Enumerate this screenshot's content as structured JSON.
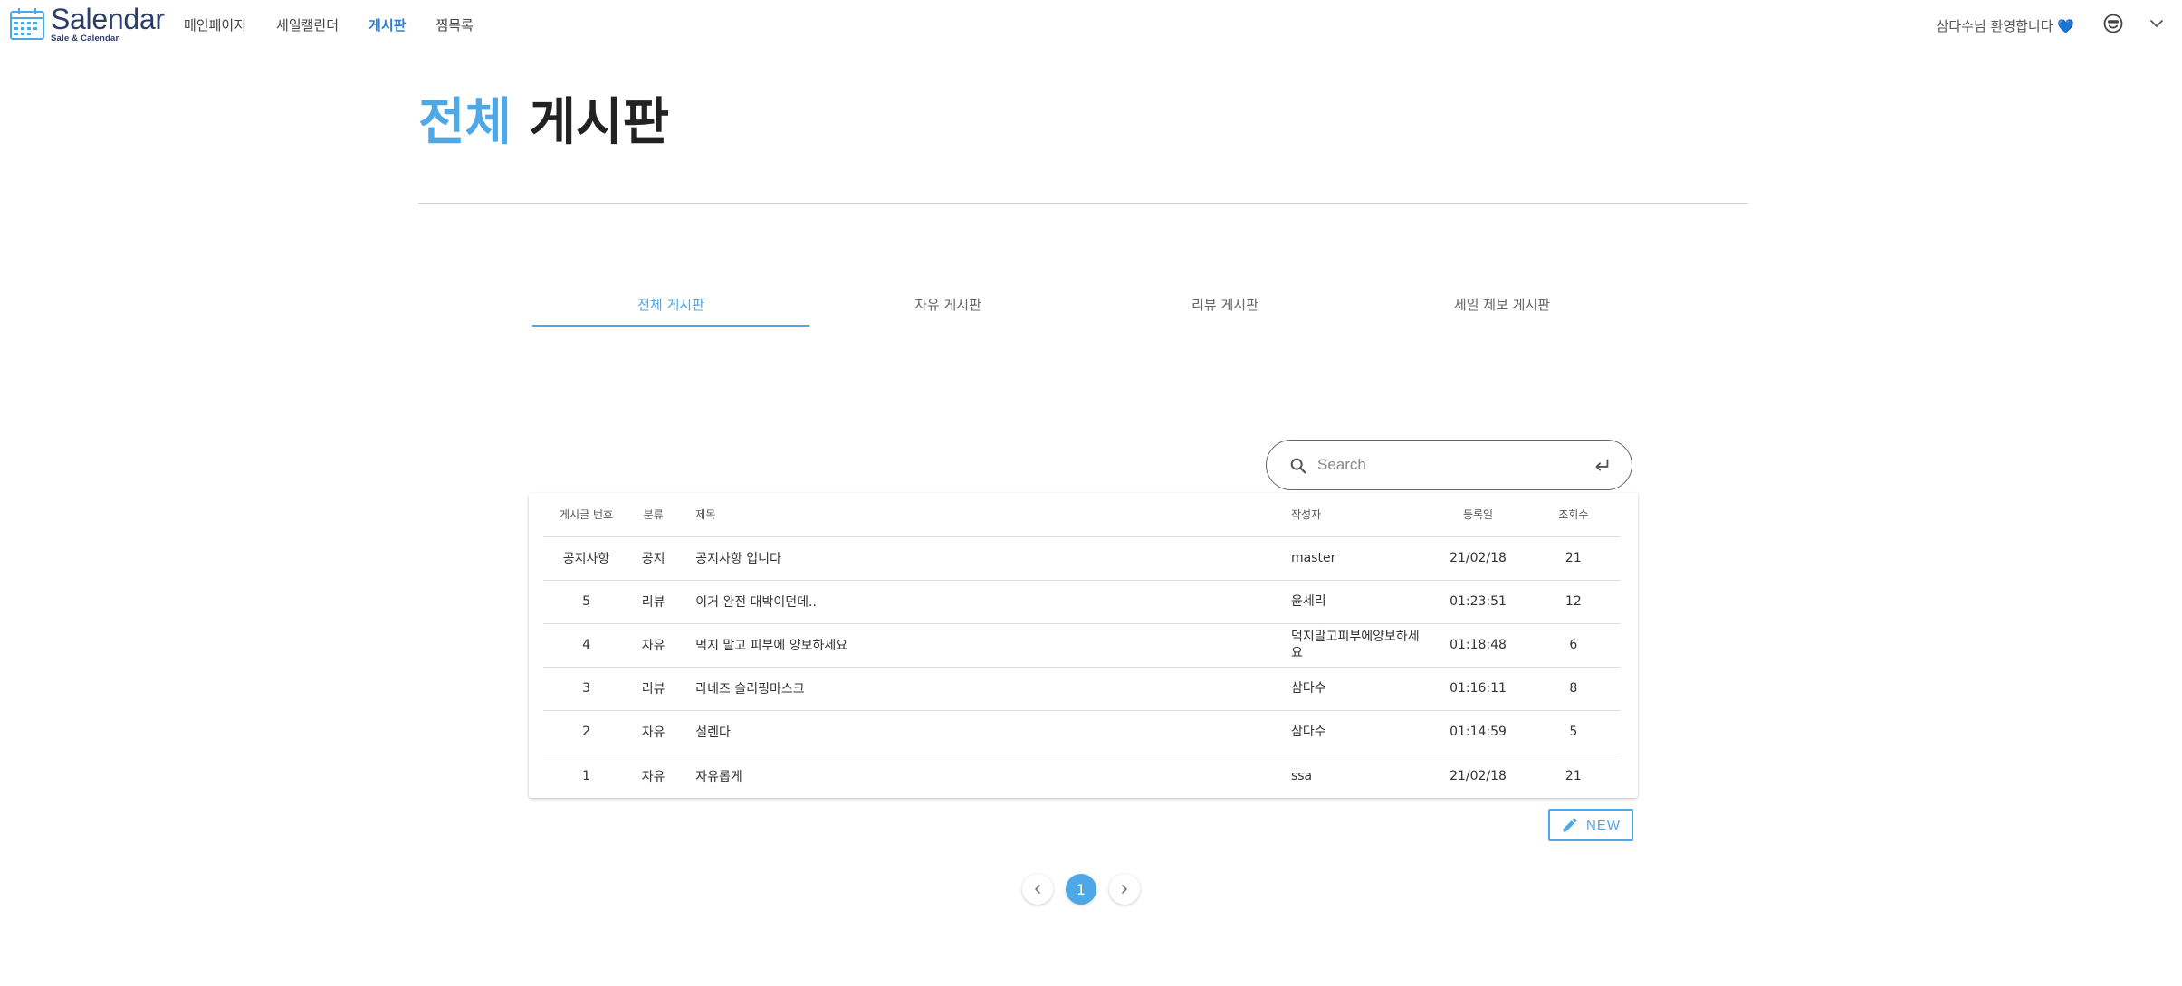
{
  "nav": {
    "logo_title": "Salendar",
    "logo_subtitle": "Sale & Calendar",
    "links": [
      {
        "label": "메인페이지",
        "active": false
      },
      {
        "label": "세일캘린더",
        "active": false
      },
      {
        "label": "게시판",
        "active": true
      },
      {
        "label": "찜목록",
        "active": false
      }
    ],
    "welcome_text": "삼다수님 환영합니다",
    "welcome_emoji": "💙",
    "icons": [
      "smiley-face-icon",
      "chevron-down-icon"
    ]
  },
  "header": {
    "title_accent": "전체",
    "title_rest": " 게시판"
  },
  "tabs": [
    {
      "label": "전체 게시판",
      "active": true
    },
    {
      "label": "자유 게시판",
      "active": false
    },
    {
      "label": "리뷰 게시판",
      "active": false
    },
    {
      "label": "세일 제보 게시판",
      "active": false
    }
  ],
  "search": {
    "placeholder": "Search",
    "value": ""
  },
  "table": {
    "columns": [
      "게시글 번호",
      "분류",
      "제목",
      "작성자",
      "등록일",
      "조회수"
    ],
    "rows": [
      {
        "no": "공지사항",
        "category": "공지",
        "title": "공지사항 입니다",
        "writer": "master",
        "date": "21/02/18",
        "views": "21"
      },
      {
        "no": "5",
        "category": "리뷰",
        "title": "이거 완전 대박이던데..",
        "writer": "윤세리",
        "date": "01:23:51",
        "views": "12"
      },
      {
        "no": "4",
        "category": "자유",
        "title": "먹지 말고 피부에 양보하세요",
        "writer": "먹지말고피부에양보하세요",
        "date": "01:18:48",
        "views": "6"
      },
      {
        "no": "3",
        "category": "리뷰",
        "title": "라네즈 슬리핑마스크",
        "writer": "삼다수",
        "date": "01:16:11",
        "views": "8"
      },
      {
        "no": "2",
        "category": "자유",
        "title": "설렌다",
        "writer": "삼다수",
        "date": "01:14:59",
        "views": "5"
      },
      {
        "no": "1",
        "category": "자유",
        "title": "자유롭게",
        "writer": "ssa",
        "date": "21/02/18",
        "views": "21"
      }
    ]
  },
  "new_button": {
    "label": "NEW"
  },
  "pagination": {
    "current": "1",
    "pages": [
      "1"
    ]
  },
  "colors": {
    "accent": "#4ea8e6",
    "nav_active": "#2f7fd6",
    "logo": "#2c3e6b"
  }
}
